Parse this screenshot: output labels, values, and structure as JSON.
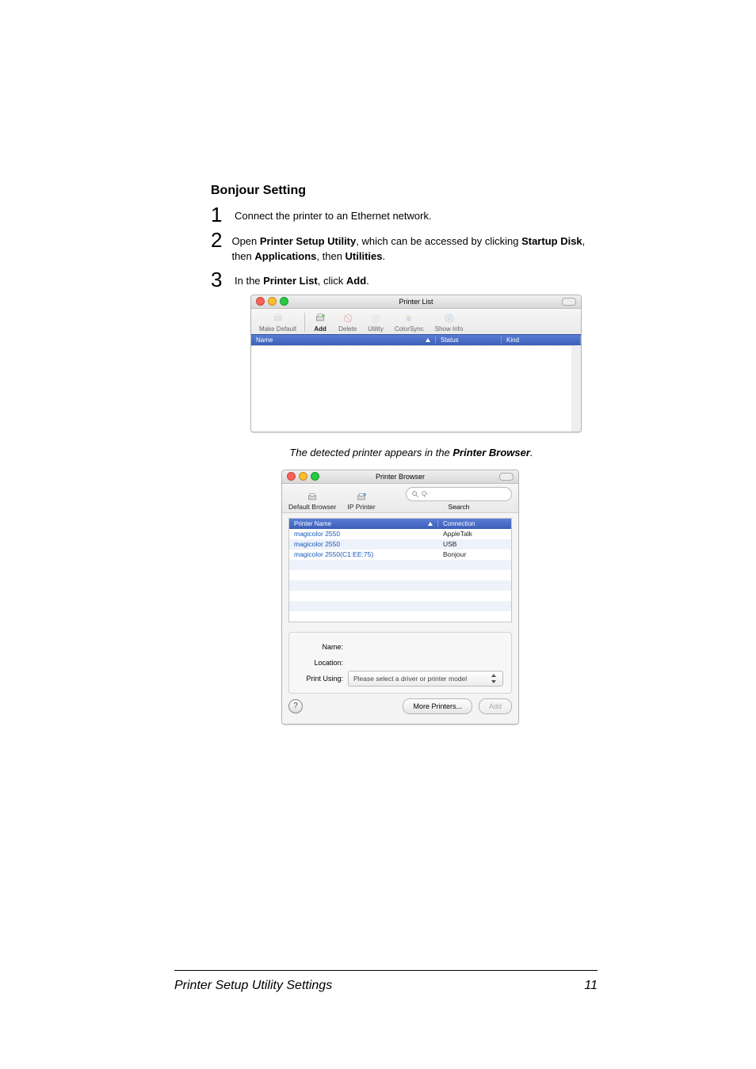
{
  "section_title": "Bonjour Setting",
  "steps": {
    "s1_text": "Connect the printer to an Ethernet network.",
    "s2_pre": "Open ",
    "s2_b1": "Printer Setup Utility",
    "s2_mid1": ", which can be accessed by clicking ",
    "s2_b2": "Startup Disk",
    "s2_mid2": ", then ",
    "s2_b3": "Applications",
    "s2_mid3": ", then ",
    "s2_b4": "Utilities",
    "s2_end": ".",
    "s3_pre": "In the ",
    "s3_b1": "Printer List",
    "s3_mid": ", click ",
    "s3_b2": "Add",
    "s3_end": "."
  },
  "printer_list": {
    "title": "Printer List",
    "toolbar": {
      "make_default": "Make Default",
      "add": "Add",
      "delete": "Delete",
      "utility": "Utility",
      "colorsync": "ColorSync",
      "show_info": "Show Info"
    },
    "cols": {
      "name": "Name",
      "status": "Status",
      "kind": "Kind"
    }
  },
  "caption_pre": "The detected printer appears in the ",
  "caption_b": "Printer Browser",
  "caption_end": ".",
  "printer_browser": {
    "title": "Printer Browser",
    "tabs": {
      "default_browser": "Default Browser",
      "ip_printer": "IP Printer",
      "search": "Search"
    },
    "search_prefix": "Q-",
    "th": {
      "name": "Printer Name",
      "conn": "Connection"
    },
    "rows": [
      {
        "name": "magicolor 2550",
        "conn": "AppleTalk"
      },
      {
        "name": "magicolor 2550",
        "conn": "USB"
      },
      {
        "name": "magicolor 2550(C1:EE:75)",
        "conn": "Bonjour"
      }
    ],
    "form": {
      "name_lbl": "Name:",
      "location_lbl": "Location:",
      "print_using_lbl": "Print Using:",
      "print_using_val": "Please select a driver or printer model"
    },
    "buttons": {
      "more": "More Printers...",
      "add": "Add"
    },
    "help": "?"
  },
  "footer": {
    "left": "Printer Setup Utility Settings",
    "right": "11"
  }
}
